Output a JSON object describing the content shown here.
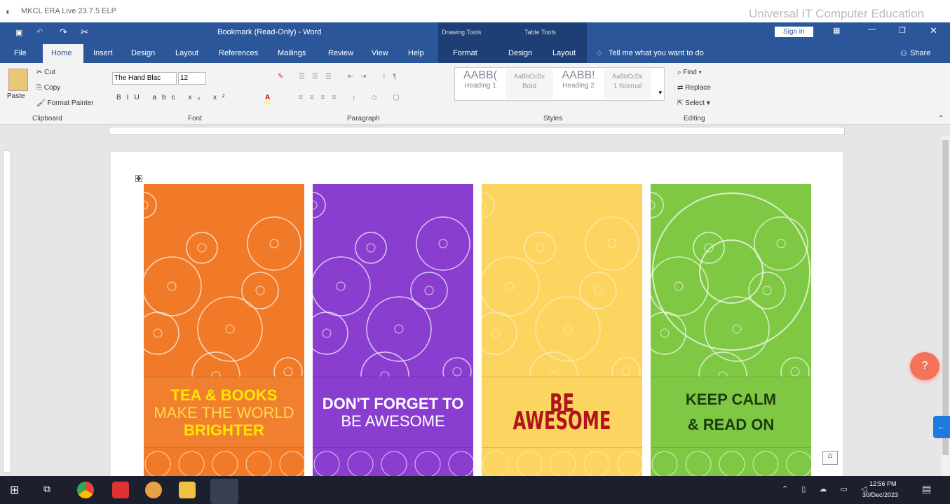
{
  "app_title": "MKCL ERA Live 23.7.5 ELP",
  "watermark": "Universal IT Computer Education",
  "window_title": "Bookmark (Read-Only) - Word",
  "context_groups": [
    "Drawing Tools",
    "Table Tools"
  ],
  "tabs": [
    "File",
    "Home",
    "Insert",
    "Design",
    "Layout",
    "References",
    "Mailings",
    "Review",
    "View",
    "Help",
    "Format",
    "Design",
    "Layout"
  ],
  "tell_me": "Tell me what you want to do",
  "sign_in": "Sign in",
  "share": "Share",
  "clipboard": {
    "paste": "Paste",
    "cut": "Cut",
    "copy": "Copy",
    "format_painter": "Format Painter",
    "label": "Clipboard"
  },
  "font": {
    "name": "The Hand Blac",
    "size": "12",
    "label": "Font"
  },
  "paragraph_label": "Paragraph",
  "styles": {
    "items": [
      {
        "preview": "AABB(",
        "name": "Heading 1"
      },
      {
        "preview": "AaBbCcDc",
        "name": "Bold"
      },
      {
        "preview": "AABB!",
        "name": "Heading 2"
      },
      {
        "preview": "AaBbCcDc",
        "name": "1 Normal"
      }
    ],
    "label": "Styles"
  },
  "editing": {
    "find": "Find",
    "replace": "Replace",
    "select": "Select",
    "label": "Editing"
  },
  "bookmarks": [
    {
      "lines": [
        "TEA & BOOKS",
        "MAKE THE WORLD",
        "BRIGHTER"
      ],
      "bg": "#f07a28",
      "band": "#f08030",
      "text": "#ffe600"
    },
    {
      "lines": [
        "DON'T FORGET TO",
        "BE AWESOME"
      ],
      "bg": "#8a3ed0",
      "band": "#8a3ed0",
      "text": "#ffffff"
    },
    {
      "lines": [
        "BE AWESOME"
      ],
      "bg": "#fcd460",
      "band": "#fcd460",
      "text": "#b0141c"
    },
    {
      "lines": [
        "KEEP CALM",
        "& READ ON"
      ],
      "bg": "#7fc844",
      "band": "#7fc844",
      "text": "#1e3a12"
    }
  ],
  "clock": {
    "time": "12:56 PM",
    "date": "30/Dec/2023"
  }
}
